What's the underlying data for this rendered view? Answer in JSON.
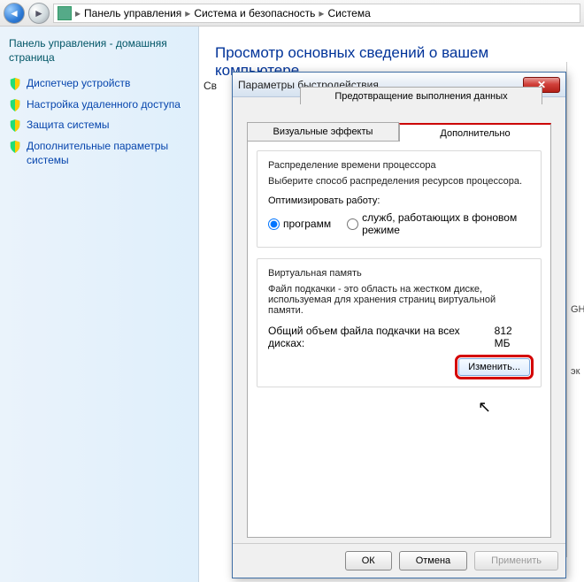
{
  "breadcrumb": {
    "items": [
      "Панель управления",
      "Система и безопасность",
      "Система"
    ]
  },
  "sidebar": {
    "home": "Панель управления - домашняя страница",
    "items": [
      {
        "label": "Диспетчер устройств"
      },
      {
        "label": "Настройка удаленного доступа"
      },
      {
        "label": "Защита системы"
      },
      {
        "label": "Дополнительные параметры системы"
      }
    ]
  },
  "content": {
    "heading": "Просмотр основных сведений о вашем компьютере",
    "truncated_label": "Св"
  },
  "right_edge": {
    "a": "GH",
    "b": "эк"
  },
  "dialog": {
    "title": "Параметры быстродействия",
    "tabs": {
      "top": "Предотвращение выполнения данных",
      "left": "Визуальные эффекты",
      "right": "Дополнительно"
    },
    "cpu": {
      "group_title": "Распределение времени процессора",
      "desc": "Выберите способ распределения ресурсов процессора.",
      "optimize_label": "Оптимизировать работу:",
      "radio_programs": "программ",
      "radio_services": "служб, работающих в фоновом режиме"
    },
    "vm": {
      "group_title": "Виртуальная память",
      "desc": "Файл подкачки - это область на жестком диске, используемая для хранения страниц виртуальной памяти.",
      "total_label": "Общий объем файла подкачки на всех дисках:",
      "total_value": "812 МБ",
      "change_button": "Изменить..."
    },
    "buttons": {
      "ok": "ОК",
      "cancel": "Отмена",
      "apply": "Применить"
    }
  }
}
